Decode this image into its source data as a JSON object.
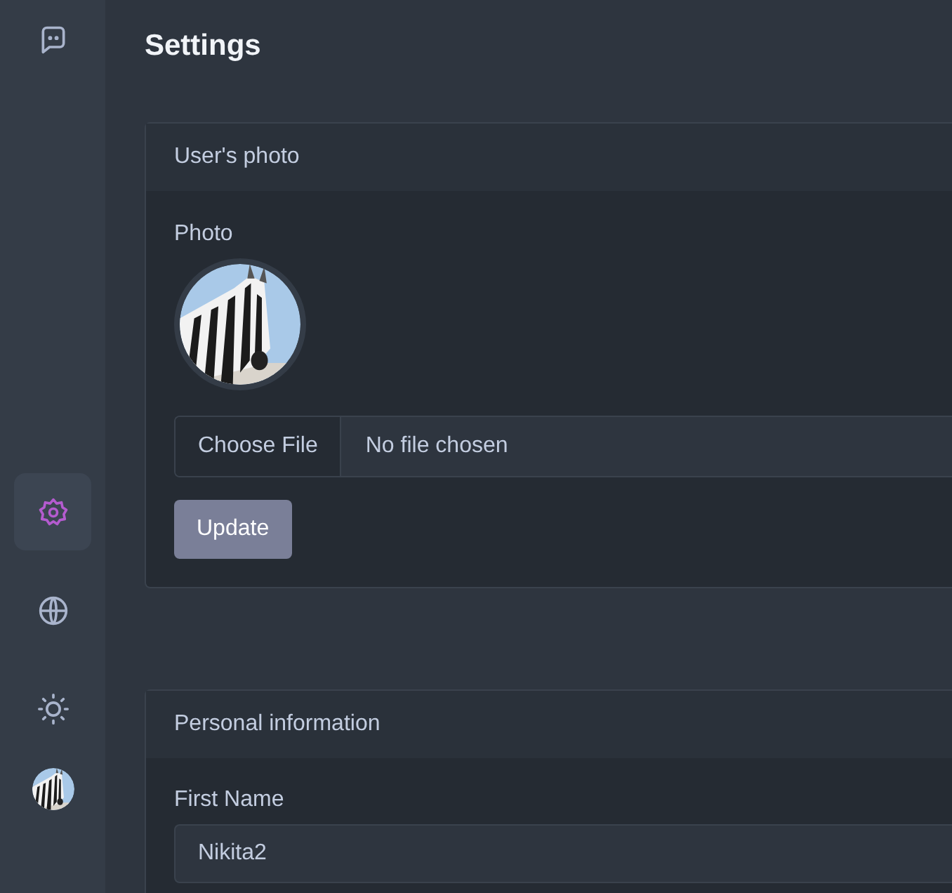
{
  "sidebar": {
    "items": [
      {
        "kind": "settings",
        "selected": true
      },
      {
        "kind": "language",
        "selected": false
      },
      {
        "kind": "theme",
        "selected": false
      }
    ]
  },
  "page_title": "Settings",
  "photo_card": {
    "title": "User's photo",
    "label": "Photo",
    "file_button": "Choose File",
    "file_status": "No file chosen",
    "submit": "Update"
  },
  "personal_card": {
    "title": "Personal information",
    "fields": [
      {
        "label": "First Name",
        "value": "Nikita2"
      }
    ]
  }
}
